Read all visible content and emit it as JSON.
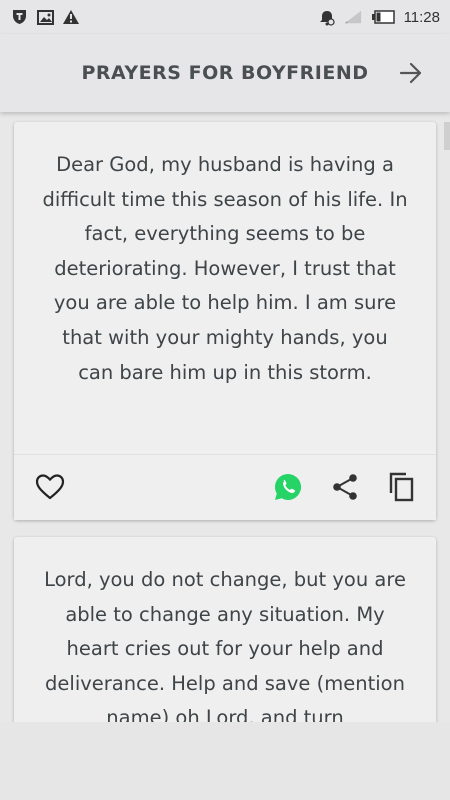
{
  "status_bar": {
    "time": "11:28",
    "left_icons": [
      "shield-icon",
      "image-icon",
      "warning-icon"
    ],
    "right_icons": [
      "alarm-icon",
      "signal-icon",
      "battery-icon"
    ]
  },
  "app_bar": {
    "title": "PRAYERS FOR BOYFRIEND",
    "forward_icon": "arrow-forward-icon"
  },
  "cards": [
    {
      "text": "Dear God, my husband is having a difficult time this season of his life. In fact, everything seems to be deteriorating. However, I trust that you are able to help him. I am sure that with your mighty hands, you can bare him up in this storm.",
      "actions": [
        "heart-icon",
        "whatsapp-icon",
        "share-icon",
        "copy-icon"
      ]
    },
    {
      "text": "Lord, you do not change, but you are able to change any situation. My heart cries out for your help and deliverance. Help and save (mention name) oh Lord, and turn"
    }
  ],
  "colors": {
    "bar_background": "#e6e6e8",
    "card_background": "#efefef",
    "text": "#3e4447",
    "whatsapp_green": "#25d366"
  }
}
